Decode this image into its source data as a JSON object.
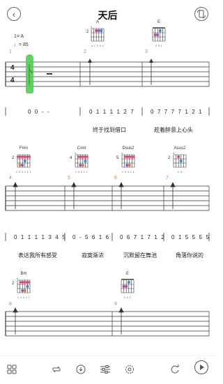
{
  "header": {
    "title": "天后"
  },
  "meta": {
    "key": "1= A",
    "tempo": "♩= 85"
  },
  "time_signature": {
    "top": "4",
    "bottom": "4"
  },
  "chords": {
    "row1": [
      {
        "name": "A",
        "fret": "2",
        "fingering": "x 1 2 3 x"
      },
      {
        "name": "E",
        "fret": "",
        "fingering": "2 3 1"
      }
    ],
    "row2": [
      {
        "name": "F#m",
        "fret": "2",
        "fingering": "1 3 4 1 1 1"
      },
      {
        "name": "C#m",
        "fret": "4",
        "fingering": "1 3 4 2 1"
      },
      {
        "name": "Dsus2",
        "fret": "5",
        "fingering": "1 3 4 1 1"
      },
      {
        "name": "Asus2",
        "fret": "2",
        "fingering": "1 3"
      }
    ],
    "row3": [
      {
        "name": "Bm",
        "fret": "2",
        "fingering": "1 3 4 2 1"
      },
      {
        "name": "E",
        "fret": "",
        "fingering": "2 3 1"
      }
    ]
  },
  "measures": [
    "1",
    "2",
    "3",
    "4",
    "5",
    "6",
    "7",
    "8",
    "9"
  ],
  "jianpu": {
    "row1": [
      "0      0 - -",
      "0 1 1 1 1 2 7",
      "0 7 7 7 7 1 2 1"
    ],
    "row2": [
      "0 1 1 1 1 3 4 5",
      "0 - 5 6 1 6",
      "0 6 7 1 7 1 2",
      "0 1 5 5 5 5"
    ]
  },
  "lyrics": {
    "row1": [
      "终于找到借口",
      "趁着醉意上心头"
    ],
    "row2": [
      "表达我所有感受",
      "寂寞渐浓",
      "沉默留在舞池",
      "角落你说的"
    ]
  }
}
